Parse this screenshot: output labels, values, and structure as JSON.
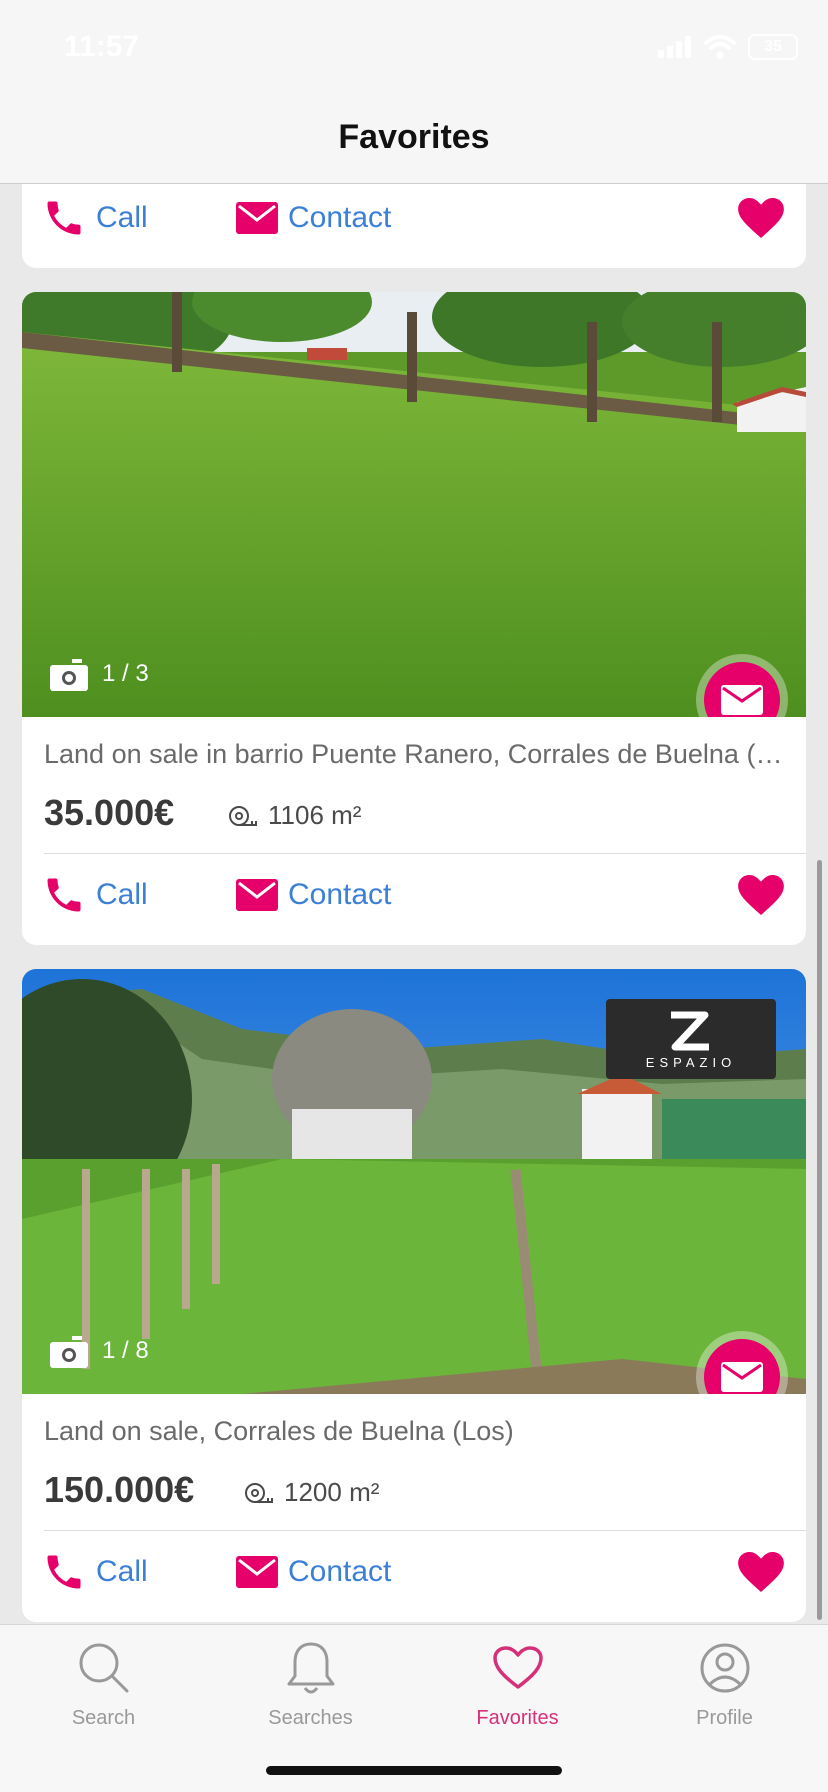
{
  "status": {
    "time": "11:57",
    "battery": "35"
  },
  "header": {
    "title": "Favorites"
  },
  "top_card": {
    "call_label": "Call",
    "contact_label": "Contact"
  },
  "cards": [
    {
      "counter": "1 / 3",
      "title": "Land on sale in barrio Puente Ranero, Corrales de Buelna (Los)",
      "price": "35.000€",
      "area": "1106 m²",
      "call_label": "Call",
      "contact_label": "Contact"
    },
    {
      "counter": "1 / 8",
      "title": "Land on sale, Corrales de Buelna (Los)",
      "price": "150.000€",
      "area": "1200 m²",
      "call_label": "Call",
      "contact_label": "Contact",
      "logo_text": "ESPAZIO"
    }
  ],
  "tabs": [
    {
      "label": "Search",
      "icon": "search-icon"
    },
    {
      "label": "Searches",
      "icon": "bell-icon"
    },
    {
      "label": "Favorites",
      "icon": "heart-icon",
      "active": true
    },
    {
      "label": "Profile",
      "icon": "profile-icon"
    }
  ],
  "colors": {
    "accent": "#e5006a",
    "link": "#3b7fd6",
    "active_tab": "#d6307a"
  }
}
